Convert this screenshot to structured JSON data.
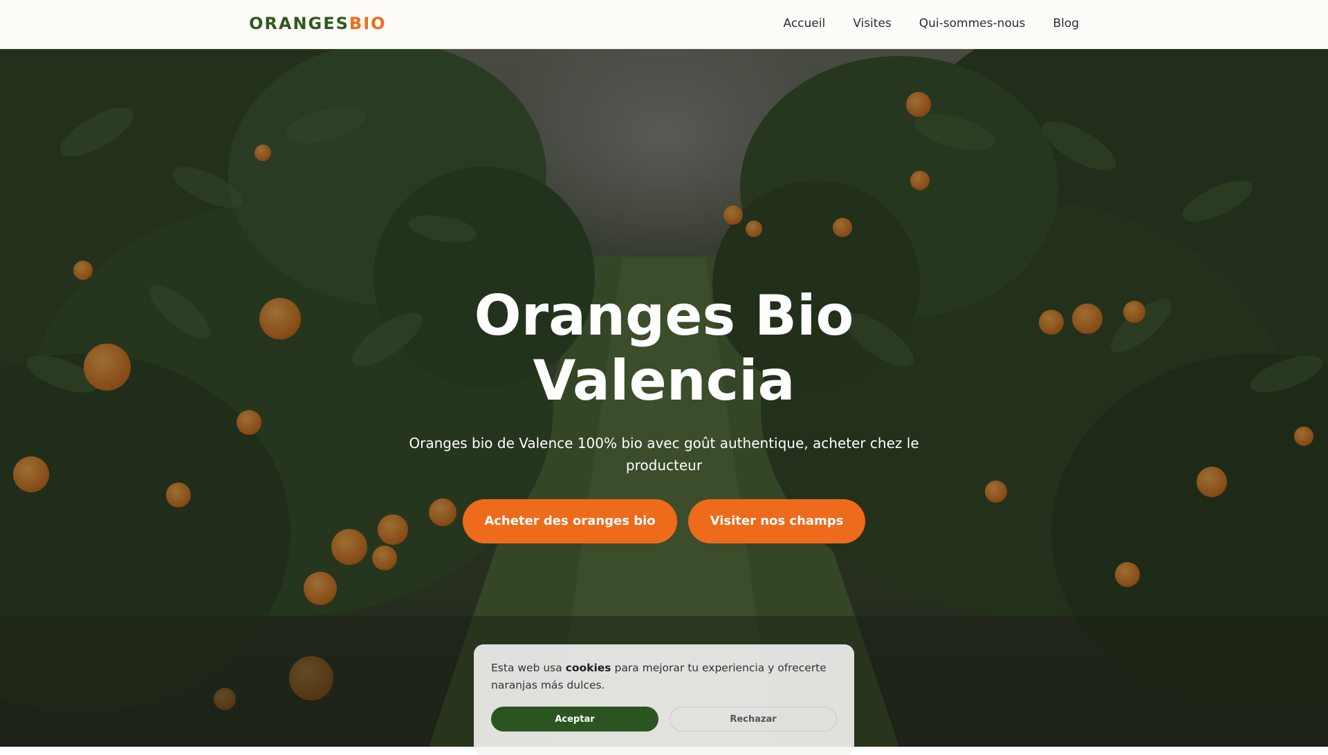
{
  "header": {
    "logo_primary": "ORANGES",
    "logo_accent": "BIO",
    "nav": [
      {
        "label": "Accueil"
      },
      {
        "label": "Visites"
      },
      {
        "label": "Qui-sommes-nous"
      },
      {
        "label": "Blog"
      }
    ]
  },
  "hero": {
    "title_line1": "Oranges Bio",
    "title_line2": "Valencia",
    "subtitle": "Oranges bio de Valence 100% bio avec goût authentique, acheter chez le producteur",
    "primary_button": "Acheter des oranges bio",
    "secondary_button": "Visiter nos champs"
  },
  "cookie_banner": {
    "text_before": "Esta web usa ",
    "text_bold": "cookies",
    "text_after": " para mejorar tu experiencia y ofrecerte naranjas más dulces.",
    "accept_label": "Aceptar",
    "reject_label": "Rechazar"
  },
  "colors": {
    "brand_green": "#2e5a1c",
    "brand_orange": "#ef6c1a",
    "cta_orange": "#ee6b1c",
    "accept_green": "#2b5520"
  }
}
